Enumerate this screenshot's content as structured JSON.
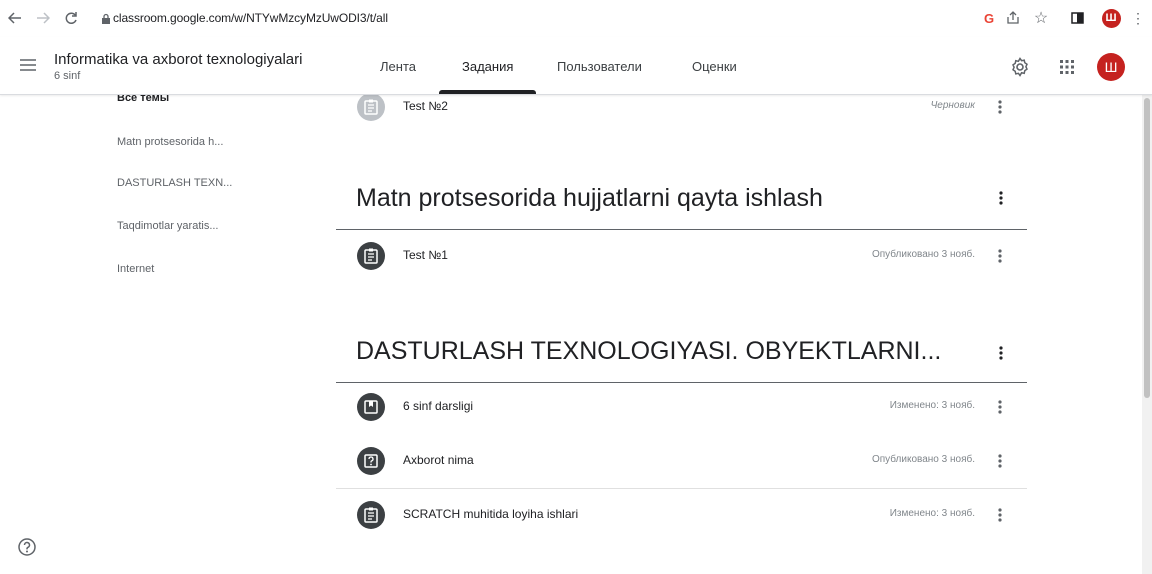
{
  "browser": {
    "url": "classroom.google.com/w/NTYwMzcyMzUwODI3/t/all",
    "profile_initial": "Ш"
  },
  "header": {
    "course_title": "Informatika va axborot texnologiyalari",
    "course_subtitle": "6 sinf",
    "tabs": [
      {
        "label": "Лента"
      },
      {
        "label": "Задания"
      },
      {
        "label": "Пользователи"
      },
      {
        "label": "Оценки"
      }
    ],
    "active_tab": "Задания",
    "avatar_initial": "Ш"
  },
  "sidebar": {
    "topics": [
      {
        "label": "Все темы"
      },
      {
        "label": "Matn protsesorida h..."
      },
      {
        "label": "DASTURLASH TEXN..."
      },
      {
        "label": "Taqdimotlar yaratis..."
      },
      {
        "label": "Internet"
      }
    ]
  },
  "stream": {
    "top_item": {
      "title": "Test №2",
      "status": "Черновик",
      "icon": "assignment-icon"
    },
    "sections": [
      {
        "title": "Matn protsesorida hujjatlarni qayta ishlash",
        "items": [
          {
            "title": "Test №1",
            "status": "Опубликовано 3 нояб.",
            "icon": "assignment-icon"
          }
        ]
      },
      {
        "title": "DASTURLASH TEXNOLOGIYASI. OBYEKTLARNI...",
        "items": [
          {
            "title": "6 sinf darsligi",
            "status": "Изменено: 3 нояб.",
            "icon": "material-icon"
          },
          {
            "title": "Axborot nima",
            "status": "Опубликовано 3 нояб.",
            "icon": "question-icon"
          },
          {
            "title": "SCRATCH muhitida loyiha ishlari",
            "status": "Изменено: 3 нояб.",
            "icon": "assignment-icon"
          }
        ]
      }
    ]
  },
  "colors": {
    "avatar": "#c5221f",
    "item_icon": "#3c4043",
    "draft_icon": "#bdc1c6"
  }
}
